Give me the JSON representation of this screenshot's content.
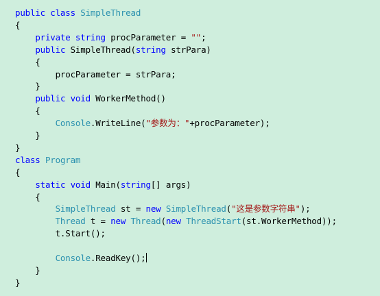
{
  "colors": {
    "background": "#cfeedd",
    "keyword": "#0000ff",
    "type": "#2b91af",
    "string": "#a31515",
    "plain": "#000000"
  },
  "code": {
    "lines": [
      [
        {
          "t": "public class ",
          "c": "kw"
        },
        {
          "t": "SimpleThread",
          "c": "ty"
        }
      ],
      [
        {
          "t": "{",
          "c": "pl"
        }
      ],
      [
        {
          "t": "    ",
          "c": "pl"
        },
        {
          "t": "private string ",
          "c": "kw"
        },
        {
          "t": "procParameter = ",
          "c": "pl"
        },
        {
          "t": "\"\"",
          "c": "str"
        },
        {
          "t": ";",
          "c": "pl"
        }
      ],
      [
        {
          "t": "    ",
          "c": "pl"
        },
        {
          "t": "public ",
          "c": "kw"
        },
        {
          "t": "SimpleThread(",
          "c": "pl"
        },
        {
          "t": "string ",
          "c": "kw"
        },
        {
          "t": "strPara)",
          "c": "pl"
        }
      ],
      [
        {
          "t": "    {",
          "c": "pl"
        }
      ],
      [
        {
          "t": "        procParameter = strPara;",
          "c": "pl"
        }
      ],
      [
        {
          "t": "    }",
          "c": "pl"
        }
      ],
      [
        {
          "t": "    ",
          "c": "pl"
        },
        {
          "t": "public void ",
          "c": "kw"
        },
        {
          "t": "WorkerMethod()",
          "c": "pl"
        }
      ],
      [
        {
          "t": "    {",
          "c": "pl"
        }
      ],
      [
        {
          "t": "        ",
          "c": "pl"
        },
        {
          "t": "Console",
          "c": "ty"
        },
        {
          "t": ".WriteLine(",
          "c": "pl"
        },
        {
          "t": "\"参数为：\"",
          "c": "str"
        },
        {
          "t": "+procParameter);",
          "c": "pl"
        }
      ],
      [
        {
          "t": "    }",
          "c": "pl"
        }
      ],
      [
        {
          "t": "}",
          "c": "pl"
        }
      ],
      [
        {
          "t": "class ",
          "c": "kw"
        },
        {
          "t": "Program",
          "c": "ty"
        }
      ],
      [
        {
          "t": "{",
          "c": "pl"
        }
      ],
      [
        {
          "t": "    ",
          "c": "pl"
        },
        {
          "t": "static void ",
          "c": "kw"
        },
        {
          "t": "Main(",
          "c": "pl"
        },
        {
          "t": "string",
          "c": "kw"
        },
        {
          "t": "[] args)",
          "c": "pl"
        }
      ],
      [
        {
          "t": "    {",
          "c": "pl"
        }
      ],
      [
        {
          "t": "        ",
          "c": "pl"
        },
        {
          "t": "SimpleThread",
          "c": "ty"
        },
        {
          "t": " st = ",
          "c": "pl"
        },
        {
          "t": "new ",
          "c": "kw"
        },
        {
          "t": "SimpleThread",
          "c": "ty"
        },
        {
          "t": "(",
          "c": "pl"
        },
        {
          "t": "\"这是参数字符串\"",
          "c": "str"
        },
        {
          "t": ");",
          "c": "pl"
        }
      ],
      [
        {
          "t": "        ",
          "c": "pl"
        },
        {
          "t": "Thread",
          "c": "ty"
        },
        {
          "t": " t = ",
          "c": "pl"
        },
        {
          "t": "new ",
          "c": "kw"
        },
        {
          "t": "Thread",
          "c": "ty"
        },
        {
          "t": "(",
          "c": "pl"
        },
        {
          "t": "new ",
          "c": "kw"
        },
        {
          "t": "ThreadStart",
          "c": "ty"
        },
        {
          "t": "(st.WorkerMethod));",
          "c": "pl"
        }
      ],
      [
        {
          "t": "        t.Start();",
          "c": "pl"
        }
      ],
      [
        {
          "t": "",
          "c": "pl"
        }
      ],
      [
        {
          "t": "        ",
          "c": "pl"
        },
        {
          "t": "Console",
          "c": "ty"
        },
        {
          "t": ".ReadKey();",
          "c": "pl"
        }
      ],
      [
        {
          "t": "    }",
          "c": "pl"
        }
      ],
      [
        {
          "t": "}",
          "c": "pl"
        }
      ]
    ]
  }
}
